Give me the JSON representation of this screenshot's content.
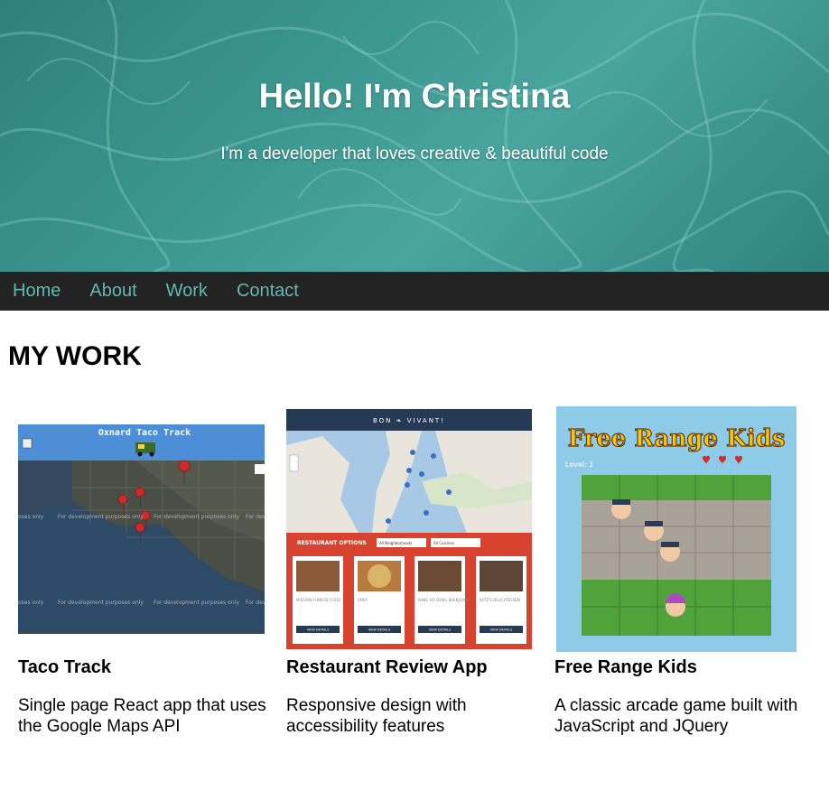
{
  "hero": {
    "title": "Hello! I'm Christina",
    "subtitle": "I'm a developer that loves creative & beautiful code"
  },
  "nav": {
    "items": [
      {
        "label": "Home"
      },
      {
        "label": "About"
      },
      {
        "label": "Work"
      },
      {
        "label": "Contact"
      }
    ]
  },
  "work": {
    "heading": "MY WORK",
    "projects": [
      {
        "title": "Taco Track",
        "description": "Single page React app that uses the Google Maps API",
        "thumb": {
          "header": "Oxnard Taco Track",
          "dev_text": "For development purposes only"
        }
      },
      {
        "title": "Restaurant Review App",
        "description": "Responsive design with accessibility features",
        "thumb": {
          "brand": "BON ❧ VIVANT!",
          "options_label": "RESTAURANT OPTIONS",
          "filter_1": "All Neighborhoods",
          "filter_2": "All Cuisines",
          "restaurants": [
            "MISSION CHINESE FOOD",
            "EMILY",
            "KANG HO DONG BAEKJEONG",
            "KATZ'S DELICATESSEN"
          ],
          "details_label": "VIEW DETAILS"
        }
      },
      {
        "title": "Free Range Kids",
        "description": "A classic arcade game built with JavaScript and JQuery",
        "thumb": {
          "game_title": "Free Range Kids",
          "level": "Level: 1"
        }
      }
    ]
  },
  "colors": {
    "hero": "#3c9690",
    "nav_bg": "#232323",
    "nav_link": "#5fb8b2"
  }
}
